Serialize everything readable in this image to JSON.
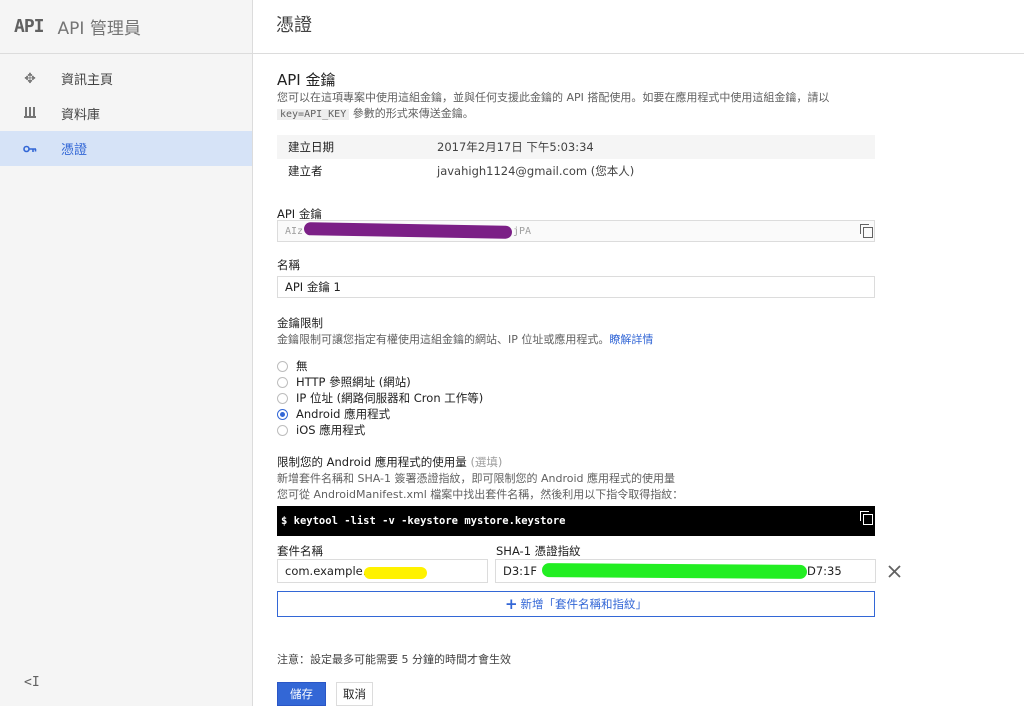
{
  "app": {
    "logo": "API",
    "title": "API 管理員"
  },
  "sidebar": {
    "items": [
      {
        "label": "資訊主頁",
        "icon": "dashboard-icon",
        "glyph": "✥"
      },
      {
        "label": "資料庫",
        "icon": "library-icon",
        "glyph": "⵿"
      },
      {
        "label": "憑證",
        "icon": "key-icon",
        "glyph": "⊶"
      }
    ],
    "collapse_label": "<I"
  },
  "header": {
    "title": "憑證"
  },
  "apikey_section": {
    "title": "API 金鑰",
    "desc_before": "您可以在這項專案中使用這組金鑰，並與任何支援此金鑰的 API 搭配使用。如要在應用程式中使用這組金鑰，請以",
    "desc_code": "key=API_KEY",
    "desc_after": "參數的形式來傳送金鑰。"
  },
  "meta": {
    "created_label": "建立日期",
    "created_value": "2017年2月17日 下午5:03:34",
    "creator_label": "建立者",
    "creator_value": "javahigh1124@gmail.com (您本人)"
  },
  "key_field": {
    "label": "API 金鑰",
    "value_start": "AIz",
    "value_end": "jPA"
  },
  "name_field": {
    "label": "名稱",
    "value": "API 金鑰 1"
  },
  "restriction": {
    "title": "金鑰限制",
    "desc": "金鑰限制可讓您指定有權使用這組金鑰的網站、IP 位址或應用程式。",
    "link": "瞭解詳情",
    "options": [
      {
        "label": "無",
        "checked": false
      },
      {
        "label": "HTTP 參照網址 (網站)",
        "checked": false
      },
      {
        "label": "IP 位址 (網路伺服器和 Cron 工作等)",
        "checked": false
      },
      {
        "label": "Android 應用程式",
        "checked": true
      },
      {
        "label": "iOS 應用程式",
        "checked": false
      }
    ]
  },
  "android": {
    "title": "限制您的 Android 應用程式的使用量",
    "optional": "(選填)",
    "desc1": "新增套件名稱和 SHA-1 簽署憑證指紋，即可限制您的 Android 應用程式的使用量",
    "desc2": "您可從 AndroidManifest.xml 檔案中找出套件名稱，然後利用以下指令取得指紋：",
    "command": "$ keytool -list -v -keystore mystore.keystore",
    "package_label": "套件名稱",
    "package_value": "com.example.",
    "sha_label": "SHA-1 憑證指紋",
    "sha_start": "D3:1F",
    "sha_end": "D7:35",
    "add_button": "新增「套件名稱和指紋」"
  },
  "note": "注意：設定最多可能需要 5 分鐘的時間才會生效",
  "buttons": {
    "save": "儲存",
    "cancel": "取消"
  },
  "colors": {
    "accent": "#3367d6",
    "redact_purple": "#7b1f86",
    "redact_yellow": "#fff200",
    "redact_green": "#22ee22"
  }
}
